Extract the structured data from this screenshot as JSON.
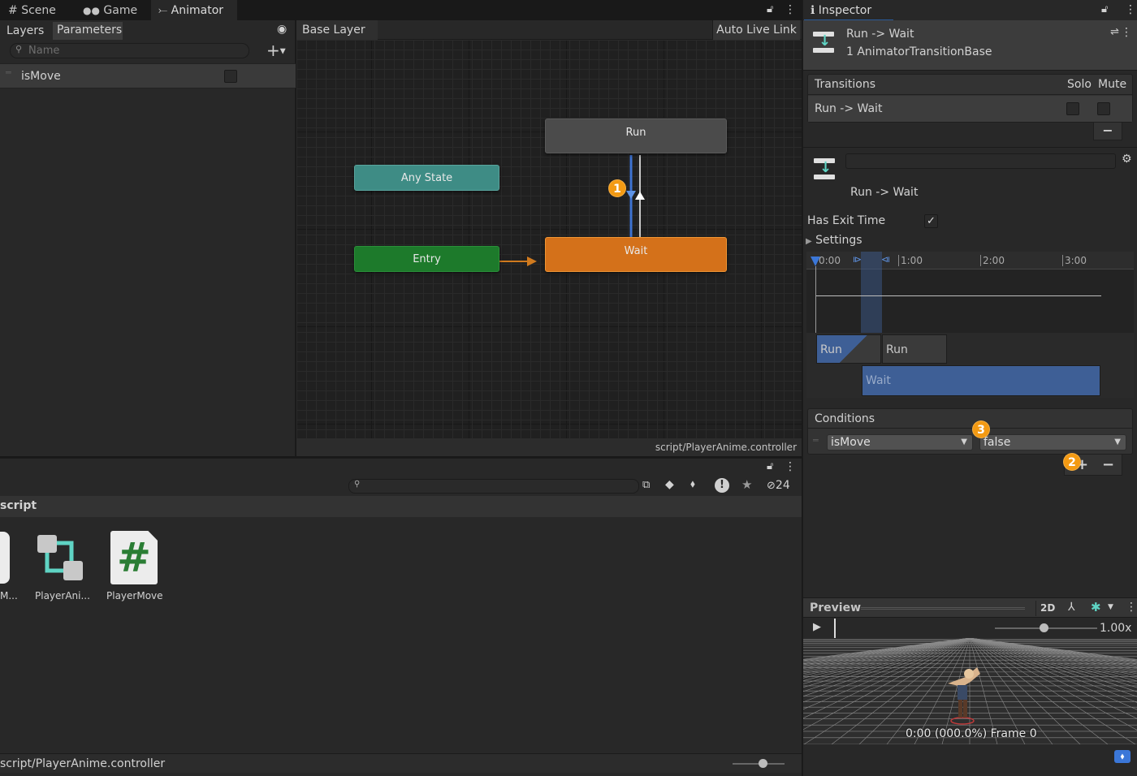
{
  "tabs": {
    "scene": "Scene",
    "game": "Game",
    "animator": "Animator",
    "inspector": "Inspector"
  },
  "animator": {
    "layers_tab": "Layers",
    "parameters_tab": "Parameters",
    "search_placeholder": "Name",
    "parameter_name": "isMove",
    "breadcrumb": "Base Layer",
    "live_link": "Auto Live Link",
    "footer_path": "script/PlayerAnime.controller",
    "states": {
      "run": "Run",
      "any_state": "Any State",
      "entry": "Entry",
      "wait": "Wait"
    }
  },
  "badges": {
    "one": "1",
    "two": "2",
    "three": "3"
  },
  "project": {
    "folder_title": "script",
    "hidden_count": "24",
    "assets": [
      {
        "label": "M...",
        "icon": "script-file-icon"
      },
      {
        "label": "PlayerAni...",
        "icon": "animator-controller-icon"
      },
      {
        "label": "PlayerMove",
        "icon": "csharp-script-icon"
      }
    ],
    "footer_path": "script/PlayerAnime.controller"
  },
  "inspector": {
    "title": "Run -> Wait",
    "subtitle": "1 AnimatorTransitionBase",
    "transitions_header": "Transitions",
    "solo": "Solo",
    "mute": "Mute",
    "transition_row": "Run -> Wait",
    "transition_name": "Run -> Wait",
    "has_exit_time": "Has Exit Time",
    "settings": "Settings",
    "timeline": {
      "ticks": [
        "0:00",
        "1:00",
        "2:00",
        "3:00"
      ],
      "clip_run_a": "Run",
      "clip_run_b": "Run",
      "clip_wait": "Wait"
    },
    "conditions_header": "Conditions",
    "condition_param": "isMove",
    "condition_value": "false"
  },
  "preview": {
    "title": "Preview",
    "mode_2d": "2D",
    "speed": "1.00x",
    "frame_info": "0:00 (000.0%) Frame 0"
  },
  "colors": {
    "any_state": "#3e8c85",
    "entry": "#1d7a2b",
    "wait": "#d4711a",
    "run": "#4a4a4a",
    "badge": "#f39a13",
    "selection_blue": "#3e5f96"
  }
}
